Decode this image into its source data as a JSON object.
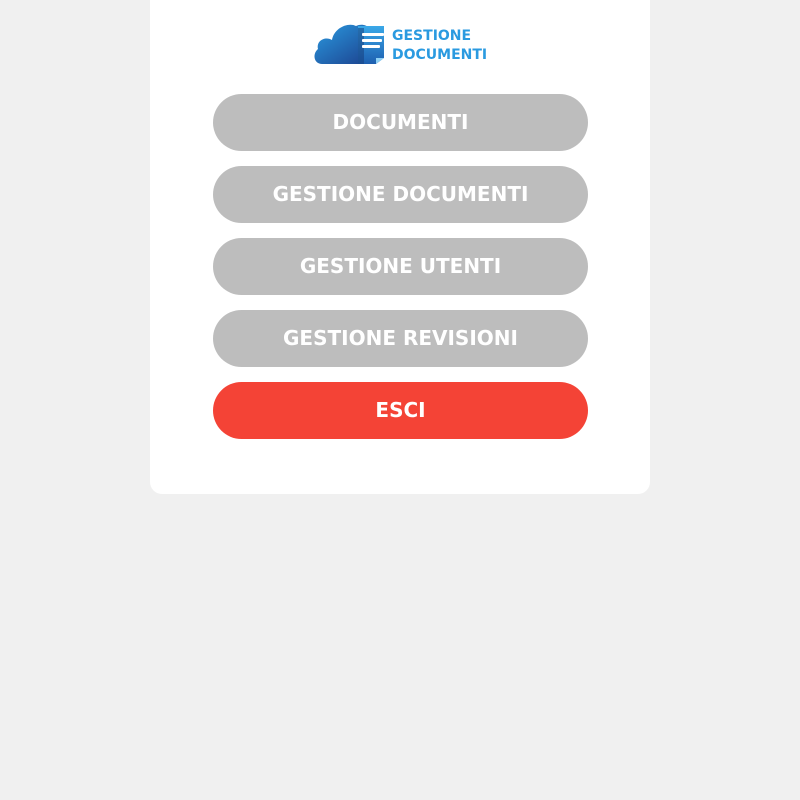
{
  "logo": {
    "line1": "GESTIONE",
    "line2": "DOCUMENTI",
    "color": "#2a9ae0",
    "icon": "cloud-document-icon"
  },
  "menu": {
    "items": [
      {
        "label": "DOCUMENTI"
      },
      {
        "label": "GESTIONE DOCUMENTI"
      },
      {
        "label": "GESTIONE UTENTI"
      },
      {
        "label": "GESTIONE REVISIONI"
      }
    ],
    "exit_label": "ESCI"
  },
  "colors": {
    "background": "#f0f0f0",
    "card": "#ffffff",
    "button": "#bdbdbd",
    "exit_button": "#f44336",
    "button_text": "#ffffff"
  }
}
